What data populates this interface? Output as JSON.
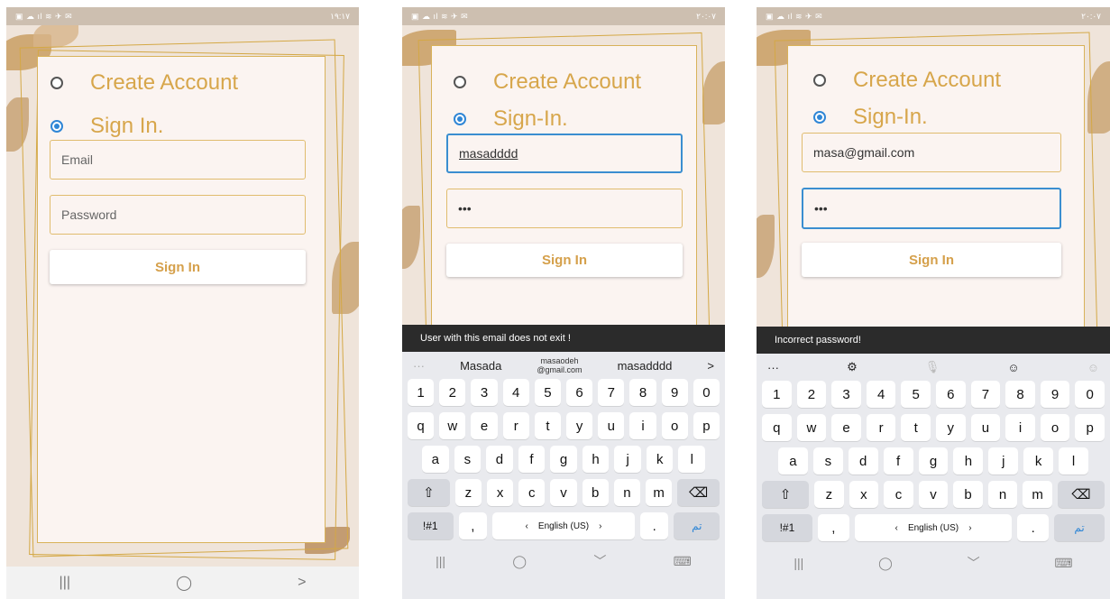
{
  "status": {
    "p1_left": "…",
    "p1_right": "١٩:١٧",
    "p2_right": "٢٠:٠٧",
    "p3_right": "٢٠:٠٧"
  },
  "screen1": {
    "create_account_label": "Create Account",
    "sign_in_label": "Sign In.",
    "email_placeholder": "Email",
    "password_placeholder": "Password",
    "sign_in_button": "Sign In"
  },
  "screen2": {
    "create_account_label": "Create Account",
    "sign_in_label": "Sign-In.",
    "email_value": "masadddd",
    "password_value": "•••",
    "sign_in_button": "Sign In",
    "toast": "User with this email does not exit !",
    "suggestions": [
      "Masada",
      "masaodeh",
      "@gmail.com",
      "masadddd"
    ]
  },
  "screen3": {
    "create_account_label": "Create Account",
    "sign_in_label": "Sign-In.",
    "email_value": "masa@gmail.com",
    "password_value": "•••",
    "sign_in_button": "Sign In",
    "toast": "Incorrect password!"
  },
  "keyboard": {
    "numbers": [
      "1",
      "2",
      "3",
      "4",
      "5",
      "6",
      "7",
      "8",
      "9",
      "0"
    ],
    "row1": [
      "q",
      "w",
      "e",
      "r",
      "t",
      "y",
      "u",
      "i",
      "o",
      "p"
    ],
    "row2": [
      "a",
      "s",
      "d",
      "f",
      "g",
      "h",
      "j",
      "k",
      "l"
    ],
    "row3": [
      "z",
      "x",
      "c",
      "v",
      "b",
      "n",
      "m"
    ],
    "sym_key": "!#1",
    "comma": ",",
    "space_label": "English (US)",
    "period": ".",
    "enter_label": "تم"
  },
  "navbar": {
    "recent": "|||",
    "home": "◯",
    "back": ">"
  },
  "colors": {
    "accent_gold": "#d7a64b",
    "radio_blue": "#2f86d6",
    "focus_blue": "#3a8ed0"
  }
}
